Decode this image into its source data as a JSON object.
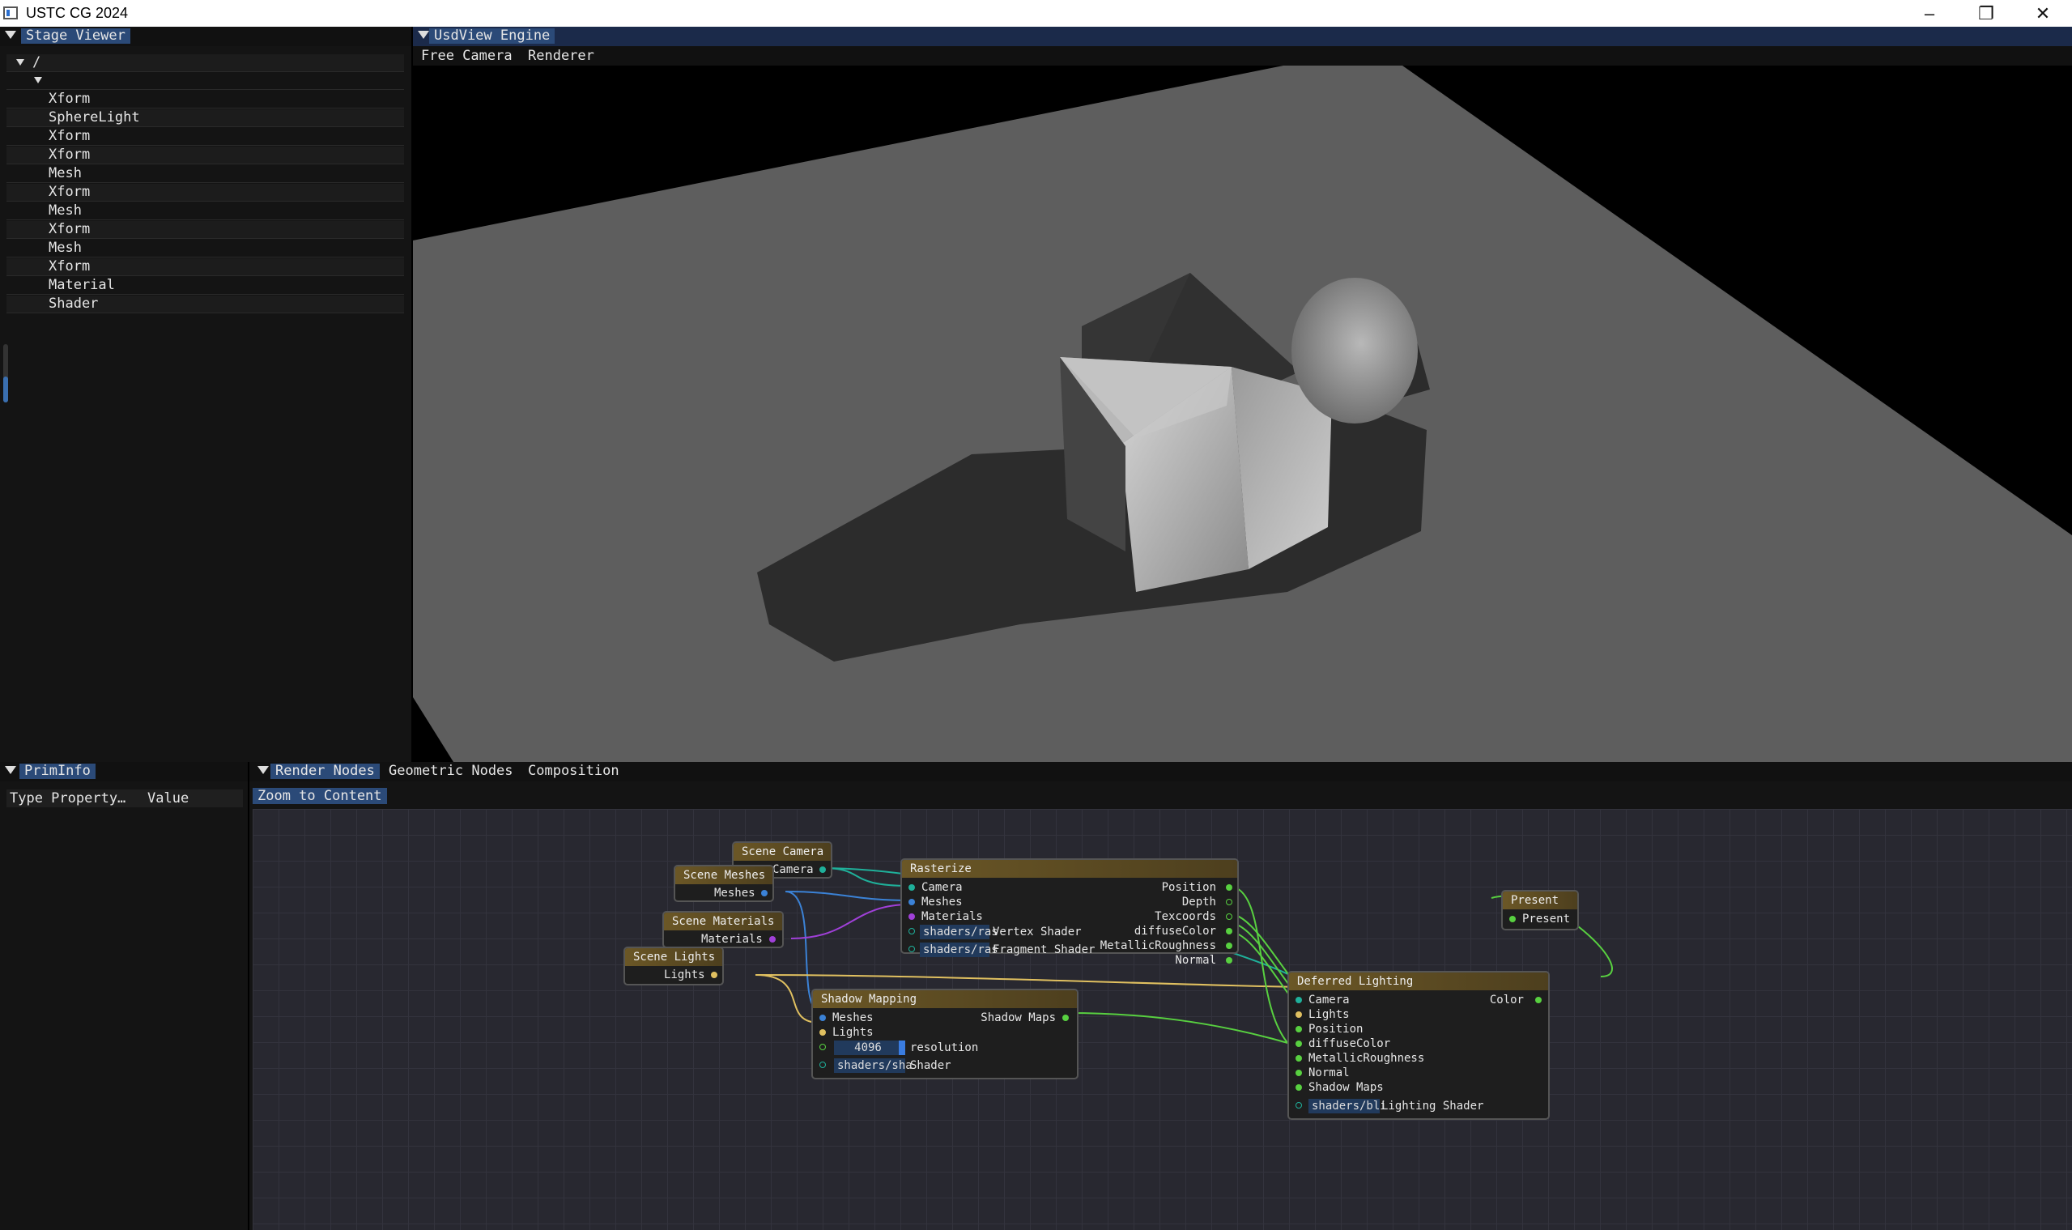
{
  "window": {
    "title": "USTC CG 2024"
  },
  "stage_viewer": {
    "tab": "Stage Viewer",
    "root": "/",
    "items": [
      "Xform",
      "SphereLight",
      "Xform",
      "Xform",
      "Mesh",
      "Xform",
      "Mesh",
      "Xform",
      "Mesh",
      "Xform",
      "Material",
      "Shader"
    ]
  },
  "viewport": {
    "tab": "UsdView Engine",
    "menu": [
      "Free Camera",
      "Renderer"
    ]
  },
  "prim_info": {
    "tab": "PrimInfo",
    "col_type_property": "Type Property…",
    "col_value": "Value"
  },
  "graph": {
    "tabs": [
      "Render Nodes",
      "Geometric Nodes",
      "Composition"
    ],
    "zoom_button": "Zoom to Content",
    "nodes": {
      "scene_camera": {
        "title": "Scene Camera",
        "out": "Camera"
      },
      "scene_meshes": {
        "title": "Scene Meshes",
        "out": "Meshes"
      },
      "scene_materials": {
        "title": "Scene Materials",
        "out": "Materials"
      },
      "scene_lights": {
        "title": "Scene Lights",
        "out": "Lights"
      },
      "rasterize": {
        "title": "Rasterize",
        "inputs": [
          "Camera",
          "Meshes",
          "Materials"
        ],
        "vs_field": "shaders/ras",
        "vs_label": "Vertex Shader",
        "fs_field": "shaders/ras",
        "fs_label": "Fragment Shader",
        "outputs": [
          "Position",
          "Depth",
          "Texcoords",
          "diffuseColor",
          "MetallicRoughness",
          "Normal"
        ]
      },
      "shadow_mapping": {
        "title": "Shadow Mapping",
        "inputs": [
          "Meshes",
          "Lights"
        ],
        "resolution_value": "4096",
        "resolution_label": "resolution",
        "shader_field": "shaders/sha",
        "shader_label": "Shader",
        "out": "Shadow Maps"
      },
      "deferred_lighting": {
        "title": "Deferred Lighting",
        "inputs": [
          "Camera",
          "Lights",
          "Position",
          "diffuseColor",
          "MetallicRoughness",
          "Normal",
          "Shadow Maps"
        ],
        "shader_field": "shaders/bli",
        "shader_label": "Lighting Shader",
        "out": "Color"
      },
      "present": {
        "title": "Present",
        "in": "Present"
      }
    },
    "colors": {
      "camera": "#1fb09a",
      "meshes": "#3b82d6",
      "materials": "#a040d8",
      "lights": "#e0c060",
      "texture": "#58d040"
    }
  }
}
